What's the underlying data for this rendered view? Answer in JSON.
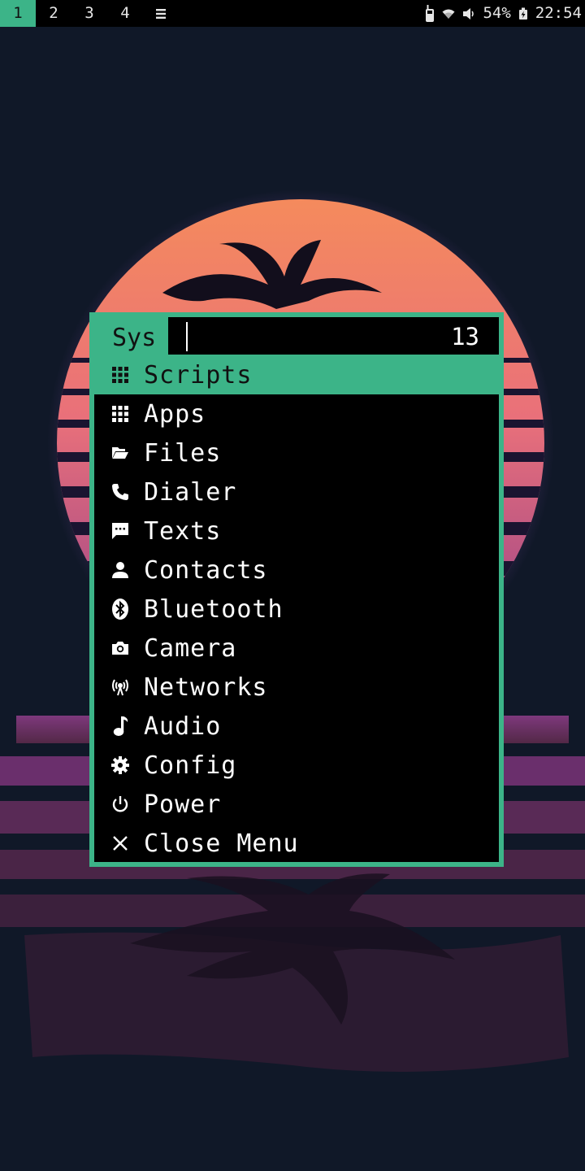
{
  "statusbar": {
    "workspaces": [
      "1",
      "2",
      "3",
      "4"
    ],
    "active_workspace": "1",
    "menu_icon": "hamburger-icon",
    "battery": "54%",
    "time": "22:54",
    "icons": [
      "phone-icon",
      "wifi-icon",
      "volume-icon",
      "charging-icon"
    ]
  },
  "menu": {
    "prompt": "Sys",
    "input_value": "",
    "count": "13",
    "selected_index": 0,
    "items": [
      {
        "label": "Scripts",
        "icon": "grid-icon"
      },
      {
        "label": "Apps",
        "icon": "grid-icon"
      },
      {
        "label": "Files",
        "icon": "folder-open-icon"
      },
      {
        "label": "Dialer",
        "icon": "phone-handset-icon"
      },
      {
        "label": "Texts",
        "icon": "message-icon"
      },
      {
        "label": "Contacts",
        "icon": "person-icon"
      },
      {
        "label": "Bluetooth",
        "icon": "bluetooth-icon"
      },
      {
        "label": "Camera",
        "icon": "camera-icon"
      },
      {
        "label": "Networks",
        "icon": "antenna-icon"
      },
      {
        "label": "Audio",
        "icon": "music-note-icon"
      },
      {
        "label": "Config",
        "icon": "gear-icon"
      },
      {
        "label": "Power",
        "icon": "power-icon"
      },
      {
        "label": "Close Menu",
        "icon": "close-icon"
      }
    ]
  },
  "colors": {
    "accent": "#3cb488",
    "menu_bg": "#000000",
    "text": "#ffffff",
    "wallpaper_bg": "#101828"
  }
}
